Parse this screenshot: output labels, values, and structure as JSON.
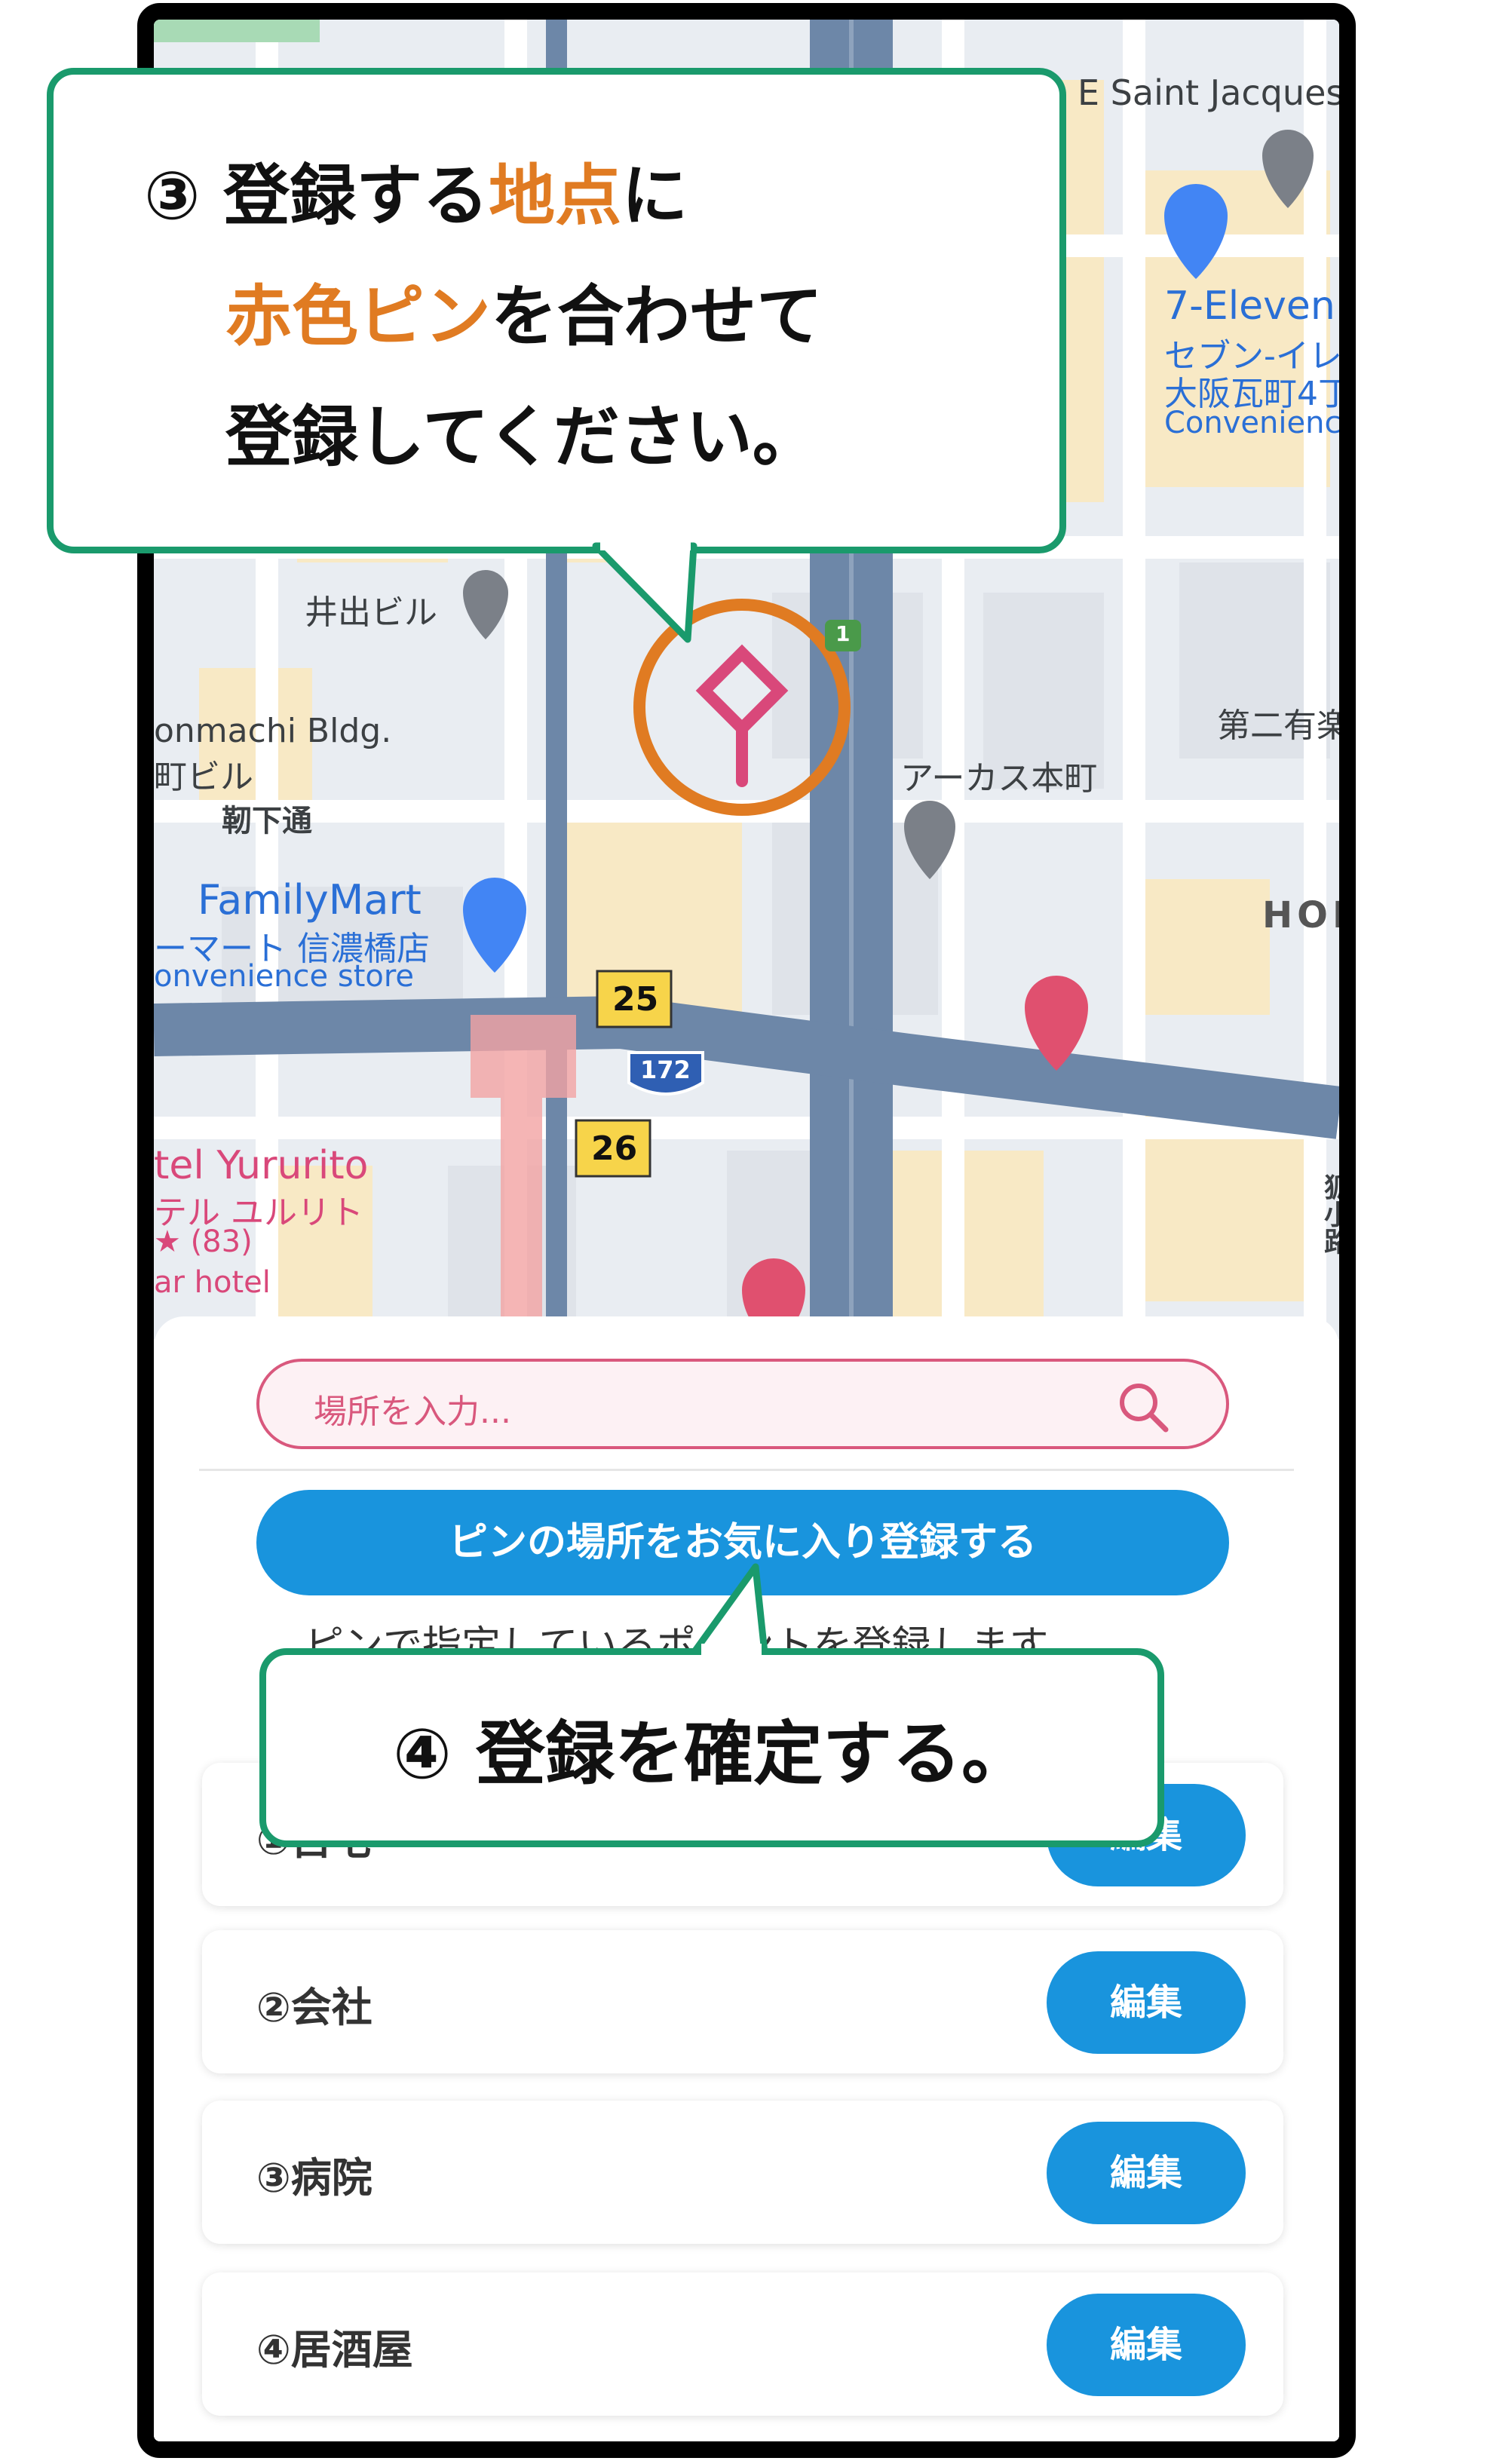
{
  "map": {
    "labels": {
      "saint_jacques": "E Saint Jacques",
      "seven_eleven": "7-Eleven",
      "seven_eleven_jp1": "セブン-イレ",
      "seven_eleven_jp2": "大阪瓦町4丁",
      "seven_eleven_type": "Convenienc",
      "ide_bldg": "井出ビル",
      "honmachi_bldg": "onmachi Bldg.",
      "honmachi_jp": "町ビル",
      "street": "靭下通",
      "arcus": "アーカス本町",
      "daini": "第二有楽",
      "familymart": "FamilyMart",
      "familymart_jp": "ーマート 信濃橋店",
      "familymart_type": "onvenience store",
      "hon": "HON",
      "hotel": "tel Yururito",
      "hotel_jp": "テル ユルリト",
      "hotel_rating": "★ (83)",
      "hotel_type": "ar hotel",
      "route_25": "25",
      "route_26": "26",
      "route_172": "172",
      "route_1": "1",
      "kitsune": "狐小路"
    },
    "colors": {
      "pin": "#d9487a",
      "target_ring": "#e07b22",
      "road": "#6d87a8"
    }
  },
  "callout3": {
    "number": "③",
    "line1_a": "登録する",
    "line1_b": "地点",
    "line1_c": "に",
    "line2_a": "赤色ピン",
    "line2_b": "を合わせて",
    "line3": "登録してください。"
  },
  "callout4": {
    "text": "④ 登録を確定する。"
  },
  "panel": {
    "search_placeholder": "場所を入力...",
    "register_button": "ピンの場所をお気に入り登録する",
    "description": "ピンで指定しているポイントを登録します。",
    "places": [
      {
        "label": "①自宅",
        "edit": "編集"
      },
      {
        "label": "②会社",
        "edit": "編集"
      },
      {
        "label": "③病院",
        "edit": "編集"
      },
      {
        "label": "④居酒屋",
        "edit": "編集"
      }
    ]
  },
  "colors": {
    "accent": "#1994dd",
    "callout_border": "#1a9a6c",
    "highlight": "#e07b22",
    "search_border": "#d9587d"
  }
}
